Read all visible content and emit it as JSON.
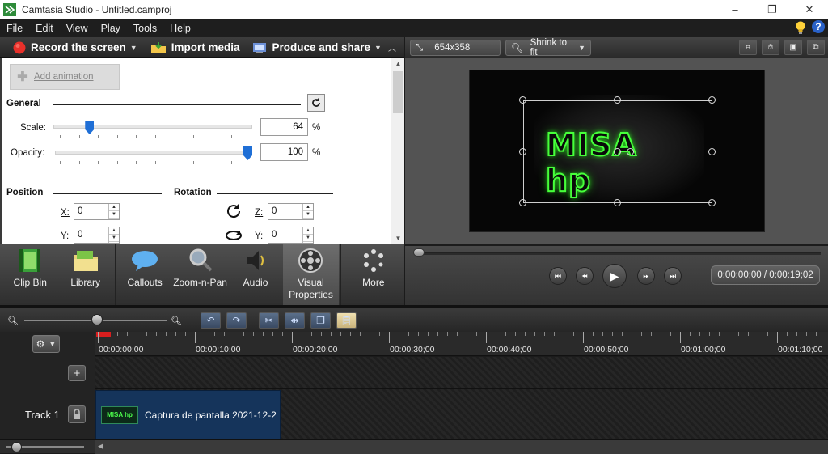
{
  "window": {
    "title": "Camtasia Studio - Untitled.camproj",
    "minimize": "–",
    "restore": "❐",
    "close": "✕"
  },
  "menu": {
    "items": [
      "File",
      "Edit",
      "View",
      "Play",
      "Tools",
      "Help"
    ],
    "help_glyph": "?"
  },
  "toolbar": {
    "record_label": "Record the screen",
    "import_label": "Import media",
    "produce_label": "Produce and share"
  },
  "properties": {
    "add_animation_label": "Add animation",
    "general_label": "General",
    "scale_label": "Scale:",
    "scale_value": "64",
    "scale_fraction": 0.16,
    "opacity_label": "Opacity:",
    "opacity_value": "100",
    "opacity_fraction": 1.0,
    "percent_sign": "%",
    "position_label": "Position",
    "rotation_label": "Rotation",
    "pos_x_label": "X:",
    "pos_x_value": "0",
    "pos_y_label": "Y:",
    "pos_y_value": "0",
    "rot_z_label": "Z:",
    "rot_z_value": "0",
    "rot_y_label": "Y:",
    "rot_y_value": "0"
  },
  "tasks": [
    {
      "label": "Clip Bin",
      "icon": "film-icon"
    },
    {
      "label": "Library",
      "icon": "folder-icon"
    },
    {
      "label": "Callouts",
      "icon": "speech-bubble-icon"
    },
    {
      "label": "Zoom-n-Pan",
      "icon": "magnifier-icon"
    },
    {
      "label": "Audio",
      "icon": "speaker-icon"
    },
    {
      "label": "Visual Properties",
      "icon": "film-reel-icon"
    },
    {
      "label": "More",
      "icon": "dots-circle-icon"
    }
  ],
  "preview": {
    "dimensions": "654x358",
    "zoom_mode": "Shrink to fit",
    "overlay_text": "MISA hp",
    "time_display": "0:00:00;00 / 0:00:19;02",
    "playback_fraction": 0.0,
    "accent_color": "#46ff3a"
  },
  "timeline": {
    "ruler_labels": [
      "00:00:00;00",
      "00:00:10;00",
      "00:00:20;00",
      "00:00:30;00",
      "00:00:40;00",
      "00:00:50;00",
      "00:01:00;00",
      "00:01:10;00"
    ],
    "track_name": "Track 1",
    "clip_name": "Captura de pantalla 2021-12-2",
    "clip_thumb_text": "MISA hp"
  }
}
